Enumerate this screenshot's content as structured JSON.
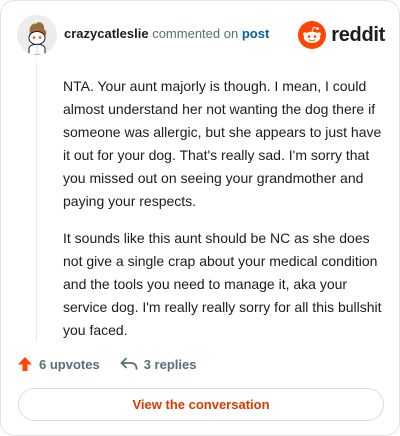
{
  "comment": {
    "username": "crazycatleslie",
    "action_text": "commented on",
    "target_link": "post",
    "paragraphs": [
      "NTA. Your aunt majorly is though. I mean, I could almost understand her not wanting the dog there if someone was allergic, but she appears to just have it out for your dog. That's really sad. I'm sorry that you missed out on seeing your grandmother and paying your respects.",
      "It sounds like this aunt should be NC as she does not give a single crap about your medical condition and the tools you need to manage it, aka your service dog. I'm really really sorry for all this bullshit you faced."
    ],
    "upvotes_label": "6 upvotes",
    "replies_label": "3 replies"
  },
  "brand": {
    "wordmark": "reddit",
    "color": "#ff4500",
    "icon": "reddit-snoo-icon"
  },
  "cta": {
    "label": "View the conversation",
    "color": "#d93a00"
  },
  "colors": {
    "upvote": "#ff4500",
    "link": "#0a5fa5",
    "muted": "#576f76"
  }
}
